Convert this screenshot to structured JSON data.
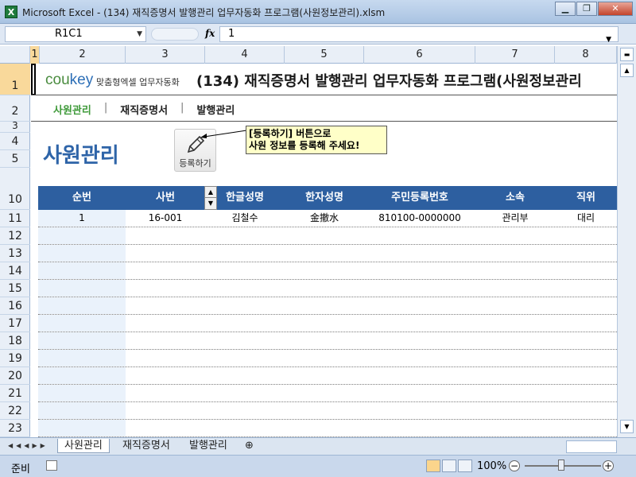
{
  "window": {
    "title": "Microsoft Excel - (134) 재직증명서 발행관리 업무자동화 프로그램(사원정보관리).xlsm",
    "app_icon": "X"
  },
  "formula_bar": {
    "name_box": "R1C1",
    "fx_label": "fx",
    "value": "1"
  },
  "columns": [
    "1",
    "2",
    "3",
    "4",
    "5",
    "6",
    "7",
    "8"
  ],
  "rows": [
    "1",
    "2",
    "3",
    "4",
    "5",
    "10",
    "11",
    "12",
    "13",
    "14",
    "15",
    "16",
    "17",
    "18",
    "19",
    "20",
    "21",
    "22",
    "23"
  ],
  "header": {
    "brand_main": "cou",
    "brand_accent": "key",
    "brand_sub": "맞춤형엑셀 업무자동화",
    "title": "(134) 재직증명서 발행관리 업무자동화 프로그램(사원정보관리"
  },
  "nav": {
    "items": [
      "사원관리",
      "재직증명서",
      "발행관리"
    ],
    "separator": "|"
  },
  "page_title": "사원관리",
  "register_button": {
    "label": "등록하기",
    "icon": "pencil-icon"
  },
  "callout": {
    "line1": "[등록하기] 버튼으로",
    "line2": "사원 정보를 등록해 주세요!"
  },
  "table": {
    "headers": [
      "순번",
      "사번",
      "한글성명",
      "한자성명",
      "주민등록번호",
      "소속",
      "직위"
    ],
    "rows": [
      [
        "1",
        "16-001",
        "김철수",
        "金撤水",
        "810100-0000000",
        "관리부",
        "대리"
      ]
    ]
  },
  "sheet_tabs": [
    "사원관리",
    "재직증명서",
    "발행관리"
  ],
  "status": {
    "ready": "준비",
    "zoom": "100%"
  },
  "colors": {
    "table_header": "#2d5fa0",
    "title_blue": "#2e64a8",
    "nav_active": "#3f9a3a",
    "callout_bg": "#ffffc8"
  }
}
